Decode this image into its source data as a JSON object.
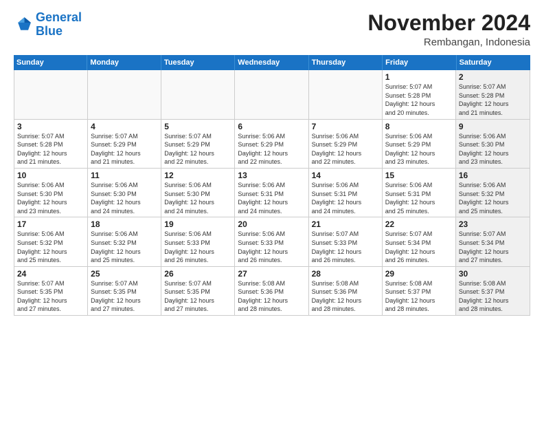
{
  "logo": {
    "line1": "General",
    "line2": "Blue"
  },
  "title": "November 2024",
  "subtitle": "Rembangan, Indonesia",
  "days_header": [
    "Sunday",
    "Monday",
    "Tuesday",
    "Wednesday",
    "Thursday",
    "Friday",
    "Saturday"
  ],
  "weeks": [
    [
      {
        "day": "",
        "info": "",
        "empty": true
      },
      {
        "day": "",
        "info": "",
        "empty": true
      },
      {
        "day": "",
        "info": "",
        "empty": true
      },
      {
        "day": "",
        "info": "",
        "empty": true
      },
      {
        "day": "",
        "info": "",
        "empty": true
      },
      {
        "day": "1",
        "info": "Sunrise: 5:07 AM\nSunset: 5:28 PM\nDaylight: 12 hours\nand 20 minutes."
      },
      {
        "day": "2",
        "info": "Sunrise: 5:07 AM\nSunset: 5:28 PM\nDaylight: 12 hours\nand 21 minutes.",
        "shaded": true
      }
    ],
    [
      {
        "day": "3",
        "info": "Sunrise: 5:07 AM\nSunset: 5:28 PM\nDaylight: 12 hours\nand 21 minutes."
      },
      {
        "day": "4",
        "info": "Sunrise: 5:07 AM\nSunset: 5:29 PM\nDaylight: 12 hours\nand 21 minutes."
      },
      {
        "day": "5",
        "info": "Sunrise: 5:07 AM\nSunset: 5:29 PM\nDaylight: 12 hours\nand 22 minutes."
      },
      {
        "day": "6",
        "info": "Sunrise: 5:06 AM\nSunset: 5:29 PM\nDaylight: 12 hours\nand 22 minutes."
      },
      {
        "day": "7",
        "info": "Sunrise: 5:06 AM\nSunset: 5:29 PM\nDaylight: 12 hours\nand 22 minutes."
      },
      {
        "day": "8",
        "info": "Sunrise: 5:06 AM\nSunset: 5:29 PM\nDaylight: 12 hours\nand 23 minutes."
      },
      {
        "day": "9",
        "info": "Sunrise: 5:06 AM\nSunset: 5:30 PM\nDaylight: 12 hours\nand 23 minutes.",
        "shaded": true
      }
    ],
    [
      {
        "day": "10",
        "info": "Sunrise: 5:06 AM\nSunset: 5:30 PM\nDaylight: 12 hours\nand 23 minutes."
      },
      {
        "day": "11",
        "info": "Sunrise: 5:06 AM\nSunset: 5:30 PM\nDaylight: 12 hours\nand 24 minutes."
      },
      {
        "day": "12",
        "info": "Sunrise: 5:06 AM\nSunset: 5:30 PM\nDaylight: 12 hours\nand 24 minutes."
      },
      {
        "day": "13",
        "info": "Sunrise: 5:06 AM\nSunset: 5:31 PM\nDaylight: 12 hours\nand 24 minutes."
      },
      {
        "day": "14",
        "info": "Sunrise: 5:06 AM\nSunset: 5:31 PM\nDaylight: 12 hours\nand 24 minutes."
      },
      {
        "day": "15",
        "info": "Sunrise: 5:06 AM\nSunset: 5:31 PM\nDaylight: 12 hours\nand 25 minutes."
      },
      {
        "day": "16",
        "info": "Sunrise: 5:06 AM\nSunset: 5:32 PM\nDaylight: 12 hours\nand 25 minutes.",
        "shaded": true
      }
    ],
    [
      {
        "day": "17",
        "info": "Sunrise: 5:06 AM\nSunset: 5:32 PM\nDaylight: 12 hours\nand 25 minutes."
      },
      {
        "day": "18",
        "info": "Sunrise: 5:06 AM\nSunset: 5:32 PM\nDaylight: 12 hours\nand 25 minutes."
      },
      {
        "day": "19",
        "info": "Sunrise: 5:06 AM\nSunset: 5:33 PM\nDaylight: 12 hours\nand 26 minutes."
      },
      {
        "day": "20",
        "info": "Sunrise: 5:06 AM\nSunset: 5:33 PM\nDaylight: 12 hours\nand 26 minutes."
      },
      {
        "day": "21",
        "info": "Sunrise: 5:07 AM\nSunset: 5:33 PM\nDaylight: 12 hours\nand 26 minutes."
      },
      {
        "day": "22",
        "info": "Sunrise: 5:07 AM\nSunset: 5:34 PM\nDaylight: 12 hours\nand 26 minutes."
      },
      {
        "day": "23",
        "info": "Sunrise: 5:07 AM\nSunset: 5:34 PM\nDaylight: 12 hours\nand 27 minutes.",
        "shaded": true
      }
    ],
    [
      {
        "day": "24",
        "info": "Sunrise: 5:07 AM\nSunset: 5:35 PM\nDaylight: 12 hours\nand 27 minutes."
      },
      {
        "day": "25",
        "info": "Sunrise: 5:07 AM\nSunset: 5:35 PM\nDaylight: 12 hours\nand 27 minutes."
      },
      {
        "day": "26",
        "info": "Sunrise: 5:07 AM\nSunset: 5:35 PM\nDaylight: 12 hours\nand 27 minutes."
      },
      {
        "day": "27",
        "info": "Sunrise: 5:08 AM\nSunset: 5:36 PM\nDaylight: 12 hours\nand 28 minutes."
      },
      {
        "day": "28",
        "info": "Sunrise: 5:08 AM\nSunset: 5:36 PM\nDaylight: 12 hours\nand 28 minutes."
      },
      {
        "day": "29",
        "info": "Sunrise: 5:08 AM\nSunset: 5:37 PM\nDaylight: 12 hours\nand 28 minutes."
      },
      {
        "day": "30",
        "info": "Sunrise: 5:08 AM\nSunset: 5:37 PM\nDaylight: 12 hours\nand 28 minutes.",
        "shaded": true
      }
    ]
  ]
}
